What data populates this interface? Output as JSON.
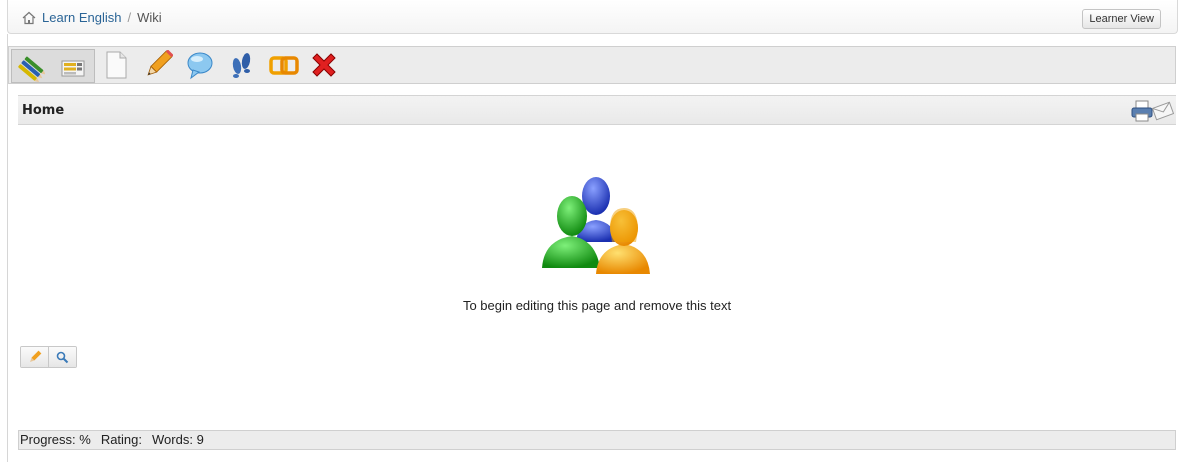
{
  "breadcrumb": {
    "items": [
      {
        "label": "Learn English",
        "icon": "home-icon"
      },
      {
        "label": "Wiki"
      }
    ],
    "separator": "/"
  },
  "header": {
    "learner_view_label": "Learner View"
  },
  "toolbar": {
    "tools": [
      {
        "name": "wiki-home-icon"
      },
      {
        "name": "list-pages-icon"
      },
      {
        "name": "new-page-icon"
      },
      {
        "name": "edit-pencil-icon"
      },
      {
        "name": "discuss-bubble-icon"
      },
      {
        "name": "footprints-history-icon"
      },
      {
        "name": "link-icon"
      },
      {
        "name": "delete-icon"
      }
    ]
  },
  "page": {
    "title": "Home",
    "intro_text": "To begin editing this page and remove this text",
    "actions": [
      "print-icon",
      "mail-icon"
    ]
  },
  "mini_buttons": [
    "pencil-icon",
    "search-icon"
  ],
  "status": {
    "progress": "Progress: %",
    "rating": "Rating:",
    "words": "Words: 9"
  },
  "colors": {
    "link": "#2a6496",
    "bar_bg": "#ececec",
    "border": "#cfcfcf"
  }
}
